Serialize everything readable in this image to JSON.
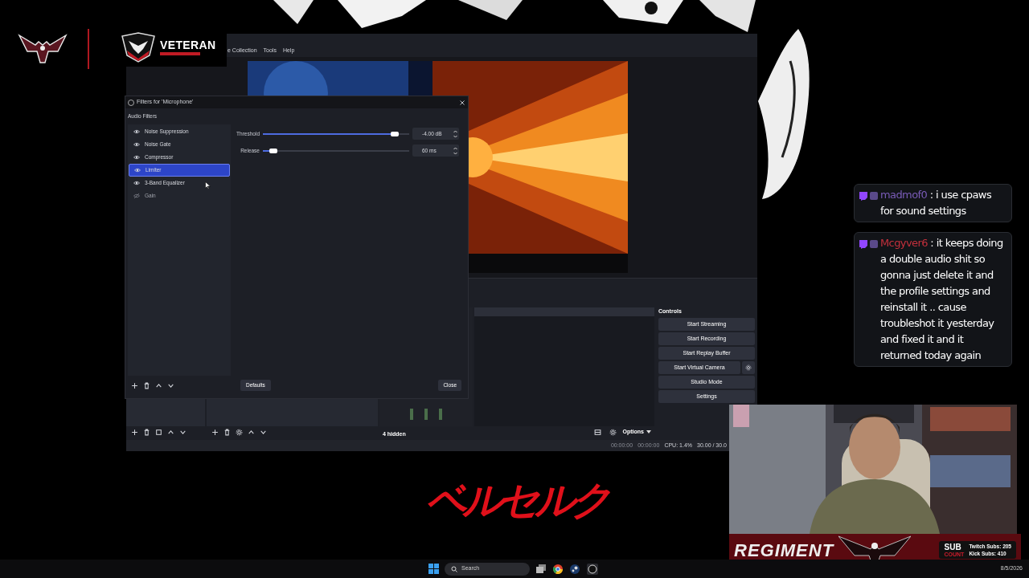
{
  "branding": {
    "logo_text": "VETERAN"
  },
  "obs_window": {
    "menu": [
      {
        "label": "e Collection"
      },
      {
        "label": "Tools"
      },
      {
        "label": "Help"
      }
    ],
    "controls": {
      "title": "Controls",
      "buttons": [
        {
          "label": "Start Streaming",
          "kind": "plain"
        },
        {
          "label": "Start Recording",
          "kind": "plain"
        },
        {
          "label": "Start Replay Buffer",
          "kind": "plain"
        },
        {
          "label": "Start Virtual Camera",
          "kind": "with_gear"
        },
        {
          "label": "Studio Mode",
          "kind": "plain"
        },
        {
          "label": "Settings",
          "kind": "plain"
        }
      ]
    },
    "mixer": {
      "hidden": "4 hidden",
      "options": "Options"
    },
    "status_bar": {
      "stream_time": "00:00:00",
      "record_time": "00:00:00",
      "cpu": "CPU: 1.4%",
      "fps": "30.00 / 30.0"
    }
  },
  "filters_dialog": {
    "title": "Filters for 'Microphone'",
    "section": "Audio Filters",
    "filters": [
      {
        "name": "Noise Suppression",
        "enabled": true,
        "selected": false
      },
      {
        "name": "Noise Gate",
        "enabled": true,
        "selected": false
      },
      {
        "name": "Compressor",
        "enabled": true,
        "selected": false
      },
      {
        "name": "Limiter",
        "enabled": true,
        "selected": true
      },
      {
        "name": "3-Band Equalizer",
        "enabled": true,
        "selected": false
      },
      {
        "name": "Gain",
        "enabled": false,
        "selected": false
      }
    ],
    "properties": [
      {
        "label": "Threshold",
        "level": 0.9,
        "value": "-4.00 dB"
      },
      {
        "label": "Release",
        "level": 0.07,
        "value": "60 ms"
      }
    ],
    "defaults": "Defaults",
    "close": "Close"
  },
  "chat": [
    {
      "user": "madmof0",
      "color": "#7a5cb8",
      "message": ": i use cpaws for sound settings"
    },
    {
      "user": "Mcgyver6",
      "color": "#c4303c",
      "message": ": it keeps doing a double audio shit so gonna just delete it and the profile settings and reinstall it .. cause troubleshot it yesterday and fixed it and it returned today again"
    }
  ],
  "overlay": {
    "title": "REGIMENT",
    "sub": "SUB",
    "count": "COUNT",
    "twitch_subs": "Twitch Subs: 205",
    "kick_subs": "Kick Subs: 410"
  },
  "show_logo": "ベルセルク",
  "taskbar": {
    "search": "Search",
    "date": "8/5/2026"
  }
}
